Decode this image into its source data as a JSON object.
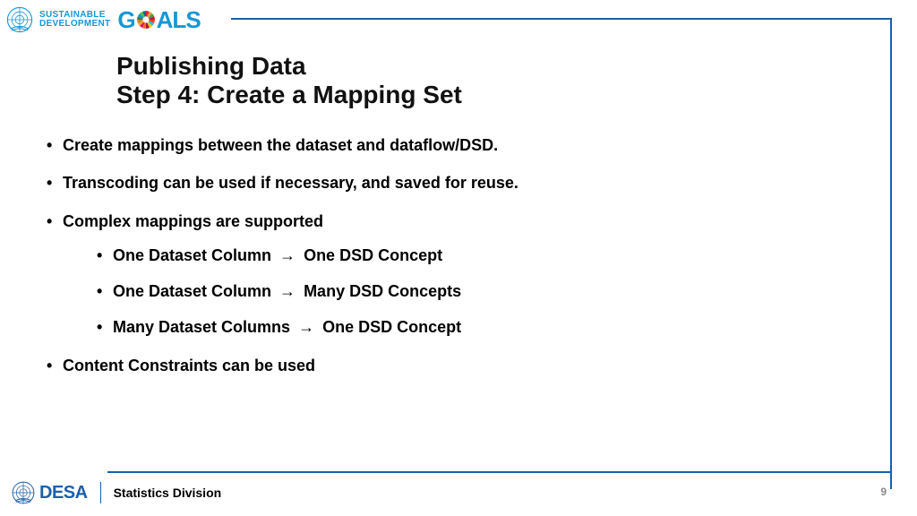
{
  "header": {
    "sdg_line1": "SUSTAINABLE",
    "sdg_line2": "DEVELOPMENT",
    "goals_g": "G",
    "goals_als": "ALS"
  },
  "title": {
    "line1": "Publishing Data",
    "line2": "Step 4: Create a Mapping Set"
  },
  "bullets": [
    "Create mappings between the dataset and dataflow/DSD.",
    "Transcoding can be used if necessary, and saved for reuse.",
    "Complex mappings are supported",
    "Content Constraints can be used"
  ],
  "sub_bullets": {
    "item0": {
      "left": "One Dataset Column",
      "right": "One DSD Concept"
    },
    "item1": {
      "left": "One Dataset Column",
      "right": "Many DSD Concepts"
    },
    "item2": {
      "left": "Many Dataset Columns",
      "right": "One DSD Concept"
    }
  },
  "arrow": "→",
  "footer": {
    "desa": "DESA",
    "division": "Statistics Division",
    "page": "9"
  }
}
